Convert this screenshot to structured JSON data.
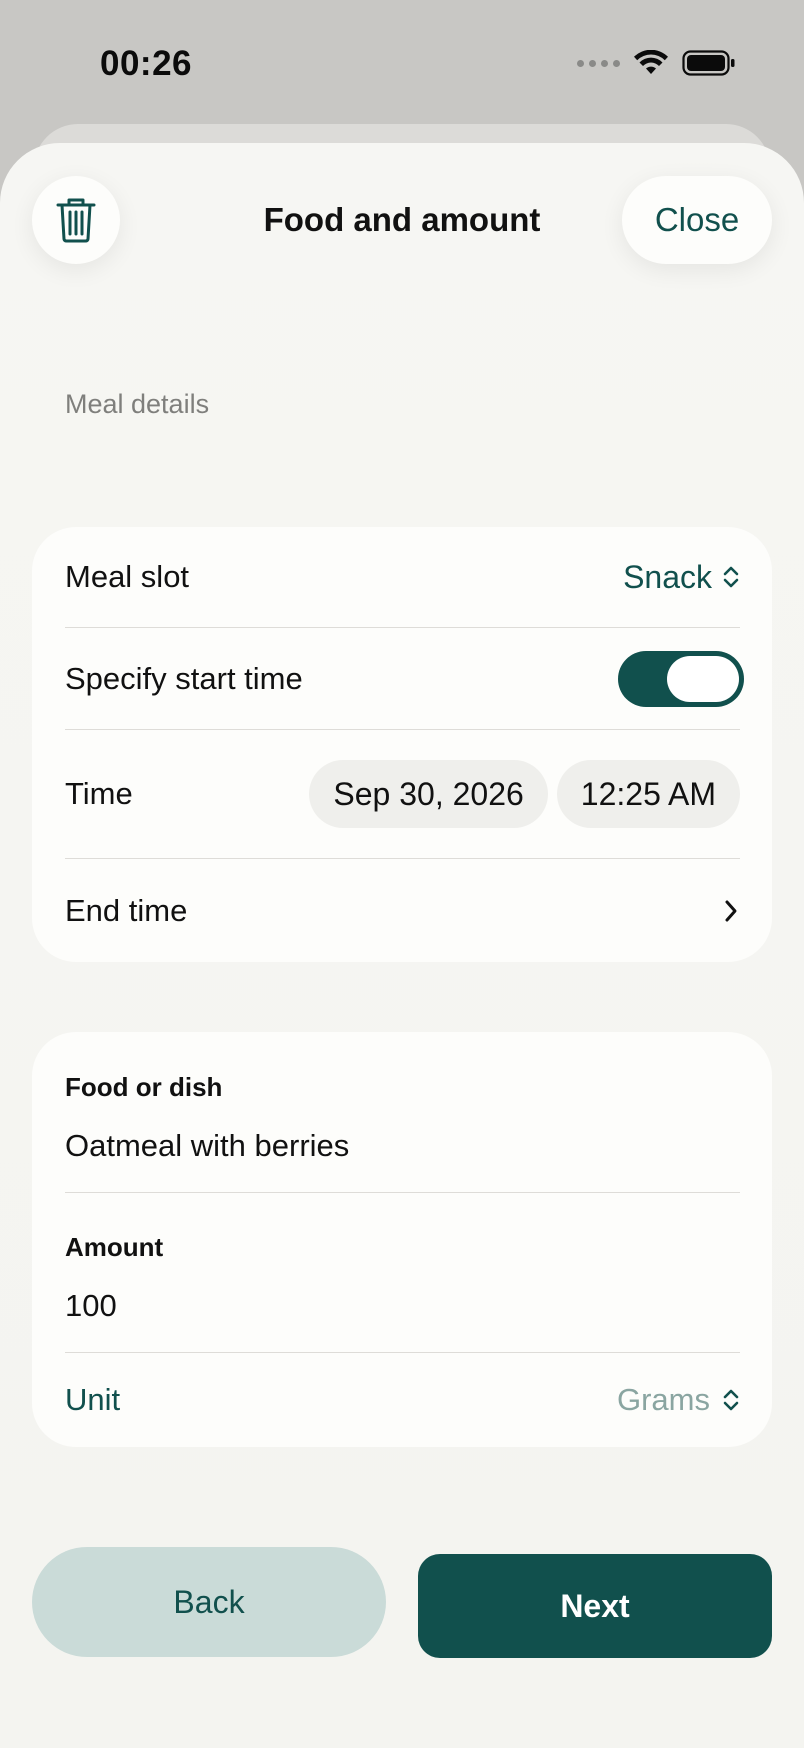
{
  "status_bar": {
    "time": "00:26"
  },
  "header": {
    "title": "Food and amount",
    "close_label": "Close"
  },
  "section": {
    "label": "Meal details"
  },
  "meal_details": {
    "meal_slot_label": "Meal slot",
    "meal_slot_value": "Snack",
    "specify_start_label": "Specify start time",
    "specify_start_on": true,
    "time_label": "Time",
    "date_value": "Sep 30, 2026",
    "time_value": "12:25 AM",
    "end_time_label": "End time"
  },
  "food": {
    "food_label": "Food or dish",
    "food_value": "Oatmeal with berries",
    "amount_label": "Amount",
    "amount_value": "100",
    "unit_label": "Unit",
    "unit_value": "Grams"
  },
  "footer": {
    "back_label": "Back",
    "next_label": "Next"
  },
  "colors": {
    "accent": "#11504d",
    "accent_soft": "#cadbd8",
    "sheet_background": "#f6f6f3"
  }
}
